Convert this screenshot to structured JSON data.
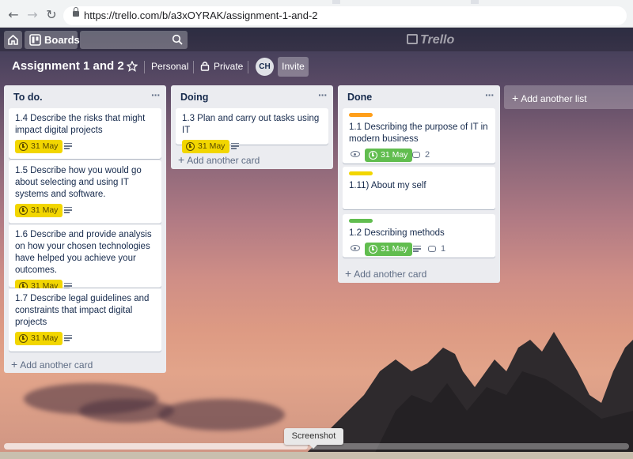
{
  "browser": {
    "url": "https://trello.com/b/a3xOYRAK/assignment-1-and-2"
  },
  "topbar": {
    "boards_label": "Boards",
    "logo_text": "Trello"
  },
  "board": {
    "title": "Assignment 1 and 2",
    "team": "Personal",
    "visibility": "Private",
    "member_initials": "CH",
    "invite_label": "Invite"
  },
  "colors": {
    "yellow_due": "#f2d600",
    "green_due": "#61bd4f",
    "orange_label": "#ff9f1a",
    "yellow_label": "#f2d600",
    "green_label": "#61bd4f"
  },
  "lists": [
    {
      "title": "To do.",
      "add_card": "Add another card",
      "cards": [
        {
          "title": "1.4 Describe the risks that might impact digital projects",
          "due": "31 May"
        },
        {
          "title": "1.5 Describe how you would go about selecting and using IT systems and software.",
          "due": "31 May"
        },
        {
          "title": "1.6 Describe and provide analysis on how your chosen technologies have helped you achieve your outcomes.",
          "due": "31 May"
        },
        {
          "title": "1.7 Describe legal guidelines and constraints that impact digital projects",
          "due": "31 May"
        }
      ]
    },
    {
      "title": "Doing",
      "add_card": "Add another card",
      "cards": [
        {
          "title": "1.3 Plan and carry out tasks using IT",
          "due": "31 May"
        }
      ]
    },
    {
      "title": "Done",
      "add_card": "Add another card",
      "cards": [
        {
          "title": "1.1 Describing the purpose of IT in modern business",
          "due": "31 May",
          "comments": "2"
        },
        {
          "title": "1.11) About my self"
        },
        {
          "title": "1.2 Describing methods",
          "due": "31 May",
          "comments": "1"
        }
      ]
    }
  ],
  "add_list_label": "Add another list",
  "tooltip_text": "Screenshot"
}
